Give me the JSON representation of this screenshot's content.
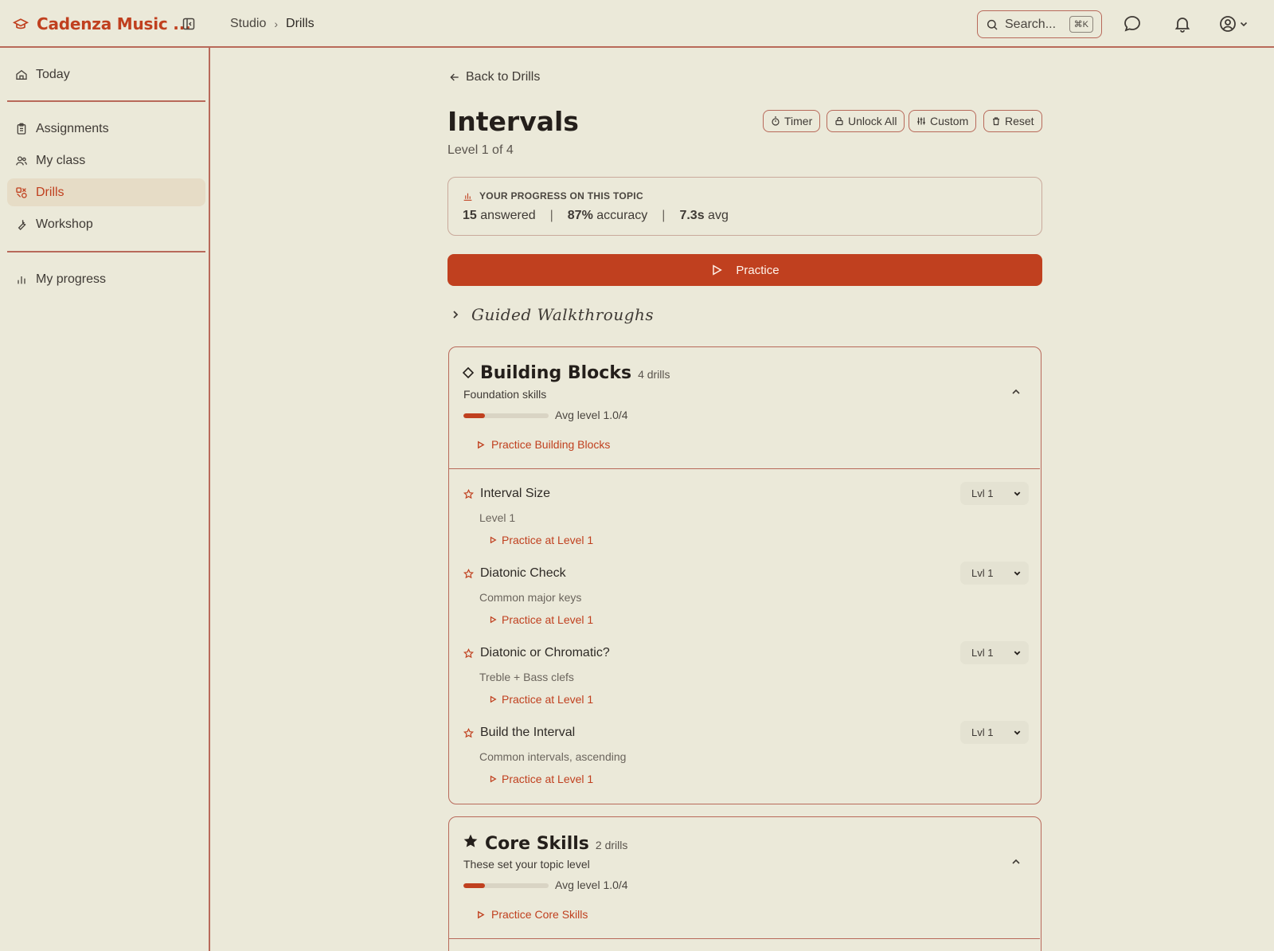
{
  "header": {
    "brand": "Cadenza Music ...",
    "breadcrumb": [
      "Studio",
      "Drills"
    ],
    "search_placeholder": "Search...",
    "search_shortcut": "⌘K"
  },
  "sidebar": {
    "items": [
      {
        "label": "Today"
      },
      {
        "label": "Assignments"
      },
      {
        "label": "My class"
      },
      {
        "label": "Drills",
        "active": true
      },
      {
        "label": "Workshop"
      },
      {
        "label": "My progress"
      }
    ]
  },
  "page": {
    "back_label": "Back to Drills",
    "title": "Intervals",
    "subtitle": "Level 1 of 4",
    "tools": [
      "Timer",
      "Unlock All",
      "Custom",
      "Reset"
    ]
  },
  "progress": {
    "heading": "YOUR PROGRESS ON THIS TOPIC",
    "answered_value": "15",
    "answered_label": "answered",
    "accuracy_value": "87%",
    "accuracy_label": "accuracy",
    "avg_value": "7.3s",
    "avg_label": "avg"
  },
  "practice_label": "Practice",
  "walkthroughs_label": "Guided Walkthroughs",
  "sections": [
    {
      "title": "Building Blocks",
      "count": "4 drills",
      "subtitle": "Foundation skills",
      "avg_label": "Avg level 1.0/4",
      "avg_fraction": 0.25,
      "practice_label": "Practice Building Blocks",
      "drills": [
        {
          "name": "Interval Size",
          "desc": "Level 1",
          "link": "Practice at Level 1",
          "level": "Lvl 1"
        },
        {
          "name": "Diatonic Check",
          "desc": "Common major keys",
          "link": "Practice at Level 1",
          "level": "Lvl 1"
        },
        {
          "name": "Diatonic or Chromatic?",
          "desc": "Treble + Bass clefs",
          "link": "Practice at Level 1",
          "level": "Lvl 1"
        },
        {
          "name": "Build the Interval",
          "desc": "Common intervals, ascending",
          "link": "Practice at Level 1",
          "level": "Lvl 1"
        }
      ]
    },
    {
      "title": "Core Skills",
      "count": "2 drills",
      "subtitle": "These set your topic level",
      "avg_label": "Avg level 1.0/4",
      "avg_fraction": 0.25,
      "practice_label": "Practice Core Skills"
    }
  ],
  "colors": {
    "accent": "#c0401f",
    "background": "#ebe9d9",
    "line": "#b8695a"
  }
}
